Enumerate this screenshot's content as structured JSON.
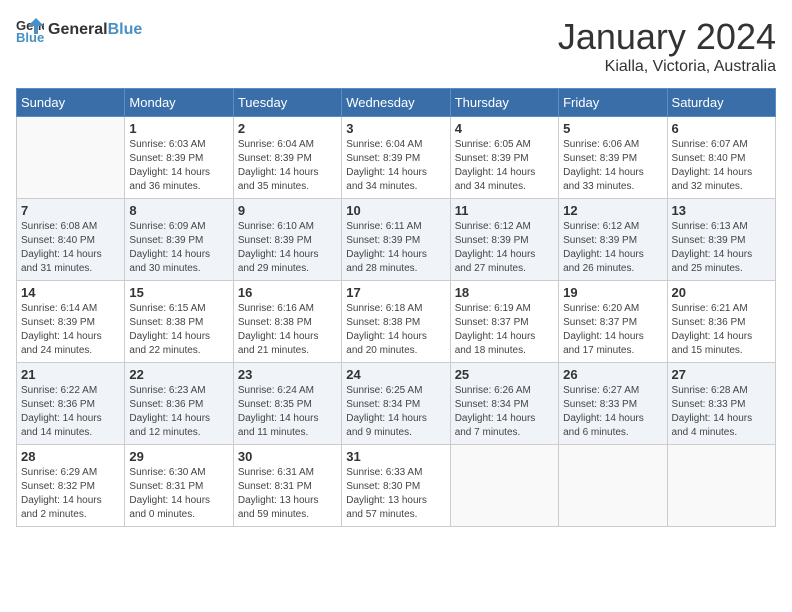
{
  "header": {
    "logo_general": "General",
    "logo_blue": "Blue",
    "month": "January 2024",
    "location": "Kialla, Victoria, Australia"
  },
  "days_of_week": [
    "Sunday",
    "Monday",
    "Tuesday",
    "Wednesday",
    "Thursday",
    "Friday",
    "Saturday"
  ],
  "weeks": [
    [
      {
        "day": "",
        "info": ""
      },
      {
        "day": "1",
        "info": "Sunrise: 6:03 AM\nSunset: 8:39 PM\nDaylight: 14 hours\nand 36 minutes."
      },
      {
        "day": "2",
        "info": "Sunrise: 6:04 AM\nSunset: 8:39 PM\nDaylight: 14 hours\nand 35 minutes."
      },
      {
        "day": "3",
        "info": "Sunrise: 6:04 AM\nSunset: 8:39 PM\nDaylight: 14 hours\nand 34 minutes."
      },
      {
        "day": "4",
        "info": "Sunrise: 6:05 AM\nSunset: 8:39 PM\nDaylight: 14 hours\nand 34 minutes."
      },
      {
        "day": "5",
        "info": "Sunrise: 6:06 AM\nSunset: 8:39 PM\nDaylight: 14 hours\nand 33 minutes."
      },
      {
        "day": "6",
        "info": "Sunrise: 6:07 AM\nSunset: 8:40 PM\nDaylight: 14 hours\nand 32 minutes."
      }
    ],
    [
      {
        "day": "7",
        "info": "Sunrise: 6:08 AM\nSunset: 8:40 PM\nDaylight: 14 hours\nand 31 minutes."
      },
      {
        "day": "8",
        "info": "Sunrise: 6:09 AM\nSunset: 8:39 PM\nDaylight: 14 hours\nand 30 minutes."
      },
      {
        "day": "9",
        "info": "Sunrise: 6:10 AM\nSunset: 8:39 PM\nDaylight: 14 hours\nand 29 minutes."
      },
      {
        "day": "10",
        "info": "Sunrise: 6:11 AM\nSunset: 8:39 PM\nDaylight: 14 hours\nand 28 minutes."
      },
      {
        "day": "11",
        "info": "Sunrise: 6:12 AM\nSunset: 8:39 PM\nDaylight: 14 hours\nand 27 minutes."
      },
      {
        "day": "12",
        "info": "Sunrise: 6:12 AM\nSunset: 8:39 PM\nDaylight: 14 hours\nand 26 minutes."
      },
      {
        "day": "13",
        "info": "Sunrise: 6:13 AM\nSunset: 8:39 PM\nDaylight: 14 hours\nand 25 minutes."
      }
    ],
    [
      {
        "day": "14",
        "info": "Sunrise: 6:14 AM\nSunset: 8:39 PM\nDaylight: 14 hours\nand 24 minutes."
      },
      {
        "day": "15",
        "info": "Sunrise: 6:15 AM\nSunset: 8:38 PM\nDaylight: 14 hours\nand 22 minutes."
      },
      {
        "day": "16",
        "info": "Sunrise: 6:16 AM\nSunset: 8:38 PM\nDaylight: 14 hours\nand 21 minutes."
      },
      {
        "day": "17",
        "info": "Sunrise: 6:18 AM\nSunset: 8:38 PM\nDaylight: 14 hours\nand 20 minutes."
      },
      {
        "day": "18",
        "info": "Sunrise: 6:19 AM\nSunset: 8:37 PM\nDaylight: 14 hours\nand 18 minutes."
      },
      {
        "day": "19",
        "info": "Sunrise: 6:20 AM\nSunset: 8:37 PM\nDaylight: 14 hours\nand 17 minutes."
      },
      {
        "day": "20",
        "info": "Sunrise: 6:21 AM\nSunset: 8:36 PM\nDaylight: 14 hours\nand 15 minutes."
      }
    ],
    [
      {
        "day": "21",
        "info": "Sunrise: 6:22 AM\nSunset: 8:36 PM\nDaylight: 14 hours\nand 14 minutes."
      },
      {
        "day": "22",
        "info": "Sunrise: 6:23 AM\nSunset: 8:36 PM\nDaylight: 14 hours\nand 12 minutes."
      },
      {
        "day": "23",
        "info": "Sunrise: 6:24 AM\nSunset: 8:35 PM\nDaylight: 14 hours\nand 11 minutes."
      },
      {
        "day": "24",
        "info": "Sunrise: 6:25 AM\nSunset: 8:34 PM\nDaylight: 14 hours\nand 9 minutes."
      },
      {
        "day": "25",
        "info": "Sunrise: 6:26 AM\nSunset: 8:34 PM\nDaylight: 14 hours\nand 7 minutes."
      },
      {
        "day": "26",
        "info": "Sunrise: 6:27 AM\nSunset: 8:33 PM\nDaylight: 14 hours\nand 6 minutes."
      },
      {
        "day": "27",
        "info": "Sunrise: 6:28 AM\nSunset: 8:33 PM\nDaylight: 14 hours\nand 4 minutes."
      }
    ],
    [
      {
        "day": "28",
        "info": "Sunrise: 6:29 AM\nSunset: 8:32 PM\nDaylight: 14 hours\nand 2 minutes."
      },
      {
        "day": "29",
        "info": "Sunrise: 6:30 AM\nSunset: 8:31 PM\nDaylight: 14 hours\nand 0 minutes."
      },
      {
        "day": "30",
        "info": "Sunrise: 6:31 AM\nSunset: 8:31 PM\nDaylight: 13 hours\nand 59 minutes."
      },
      {
        "day": "31",
        "info": "Sunrise: 6:33 AM\nSunset: 8:30 PM\nDaylight: 13 hours\nand 57 minutes."
      },
      {
        "day": "",
        "info": ""
      },
      {
        "day": "",
        "info": ""
      },
      {
        "day": "",
        "info": ""
      }
    ]
  ]
}
